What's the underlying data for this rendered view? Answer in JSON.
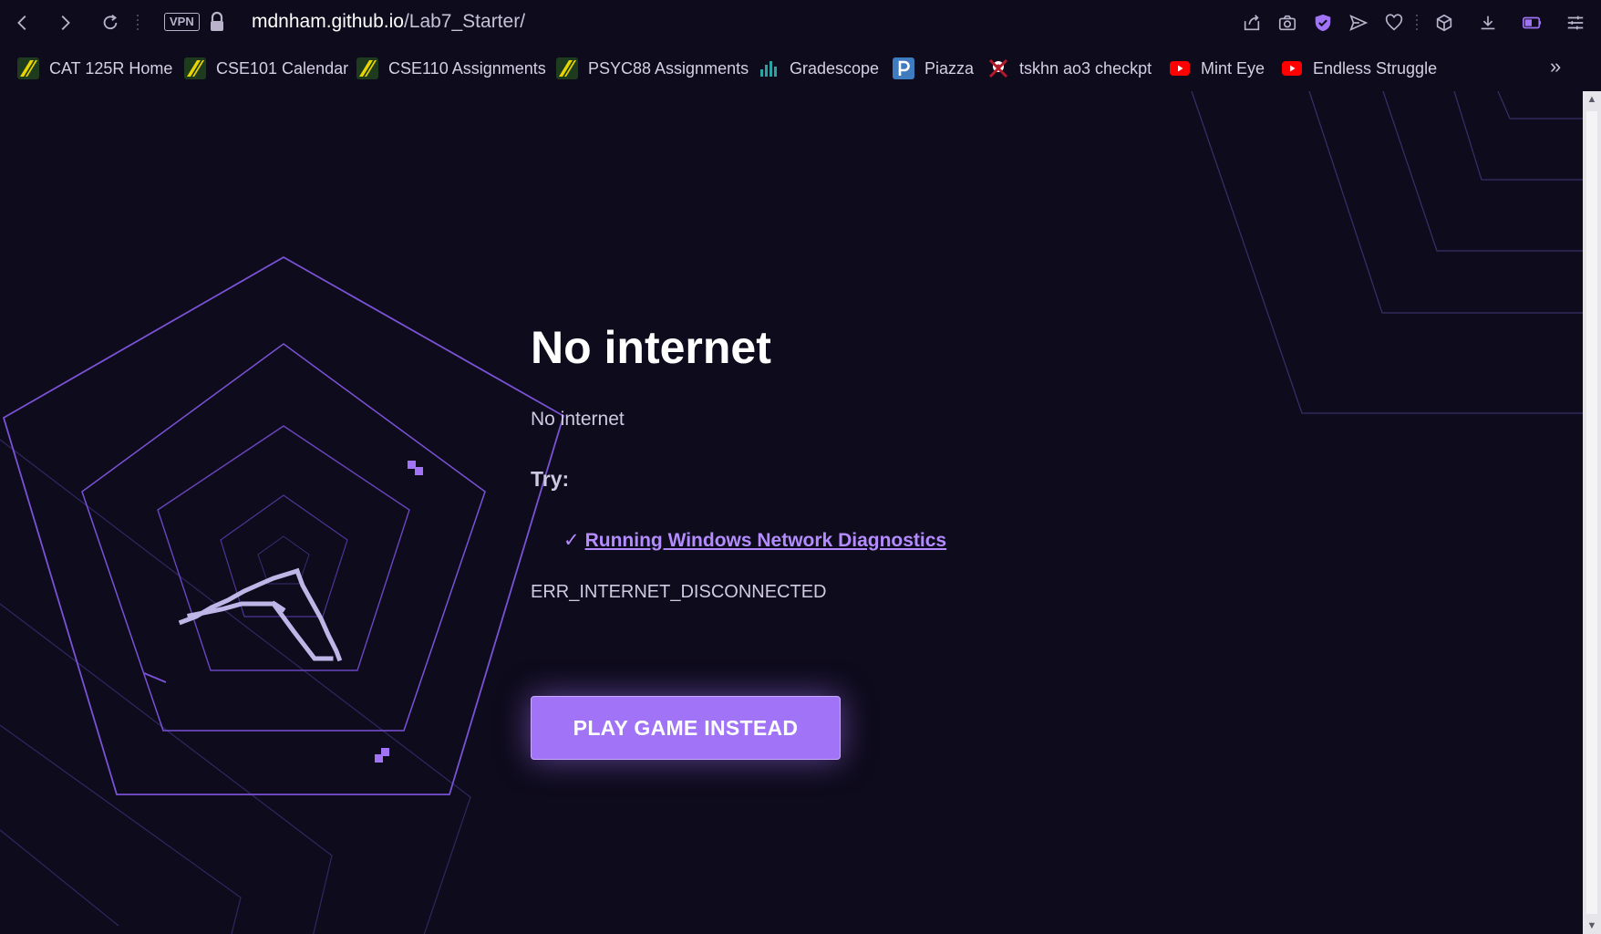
{
  "toolbar": {
    "vpn_label": "VPN",
    "url_host": "mdnham.github.io",
    "url_path": "/Lab7_Starter/"
  },
  "bookmarks": [
    {
      "label": "CAT 125R Home",
      "icon": "canvas-icon"
    },
    {
      "label": "CSE101 Calendar",
      "icon": "canvas-icon"
    },
    {
      "label": "CSE110 Assignments",
      "icon": "canvas-icon"
    },
    {
      "label": "PSYC88 Assignments",
      "icon": "canvas-icon"
    },
    {
      "label": "Gradescope",
      "icon": "gradescope-icon"
    },
    {
      "label": "Piazza",
      "icon": "piazza-icon"
    },
    {
      "label": "tskhn ao3 checkpt",
      "icon": "ao3-icon"
    },
    {
      "label": "Mint Eye",
      "icon": "youtube-icon"
    },
    {
      "label": "Endless Struggle",
      "icon": "youtube-icon"
    }
  ],
  "page": {
    "title": "No internet",
    "subtitle": "No internet",
    "try_label": "Try:",
    "suggestion_check": "✓",
    "suggestion_link": "Running Windows Network Diagnostics",
    "error_code": "ERR_INTERNET_DISCONNECTED",
    "play_button": "PLAY GAME INSTEAD"
  },
  "colors": {
    "background": "#0e0b1c",
    "accent": "#a073f7",
    "link": "#b48cff"
  }
}
